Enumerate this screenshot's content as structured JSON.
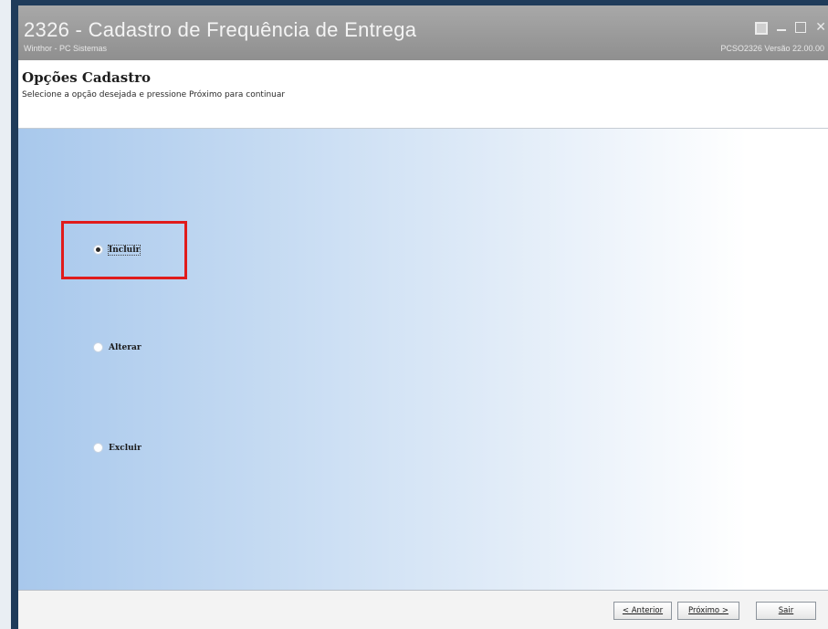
{
  "window": {
    "title": "2326 - Cadastro de Frequência de Entrega",
    "subtitle_left": "Winthor - PC Sistemas",
    "subtitle_right": "PCSO2326   Versão 22.00.00"
  },
  "header": {
    "title": "Opções Cadastro",
    "description": "Selecione a opção desejada e pressione Próximo para continuar"
  },
  "options": [
    {
      "label": "Incluir",
      "selected": true
    },
    {
      "label": "Alterar",
      "selected": false
    },
    {
      "label": "Excluir",
      "selected": false
    }
  ],
  "footer": {
    "prev_label": "< Anterior",
    "next_label": "Próximo >",
    "exit_label": "Sair"
  },
  "colors": {
    "highlight": "#e01b1b",
    "titlebar": "#999999",
    "window_border": "#1f3b5a"
  }
}
